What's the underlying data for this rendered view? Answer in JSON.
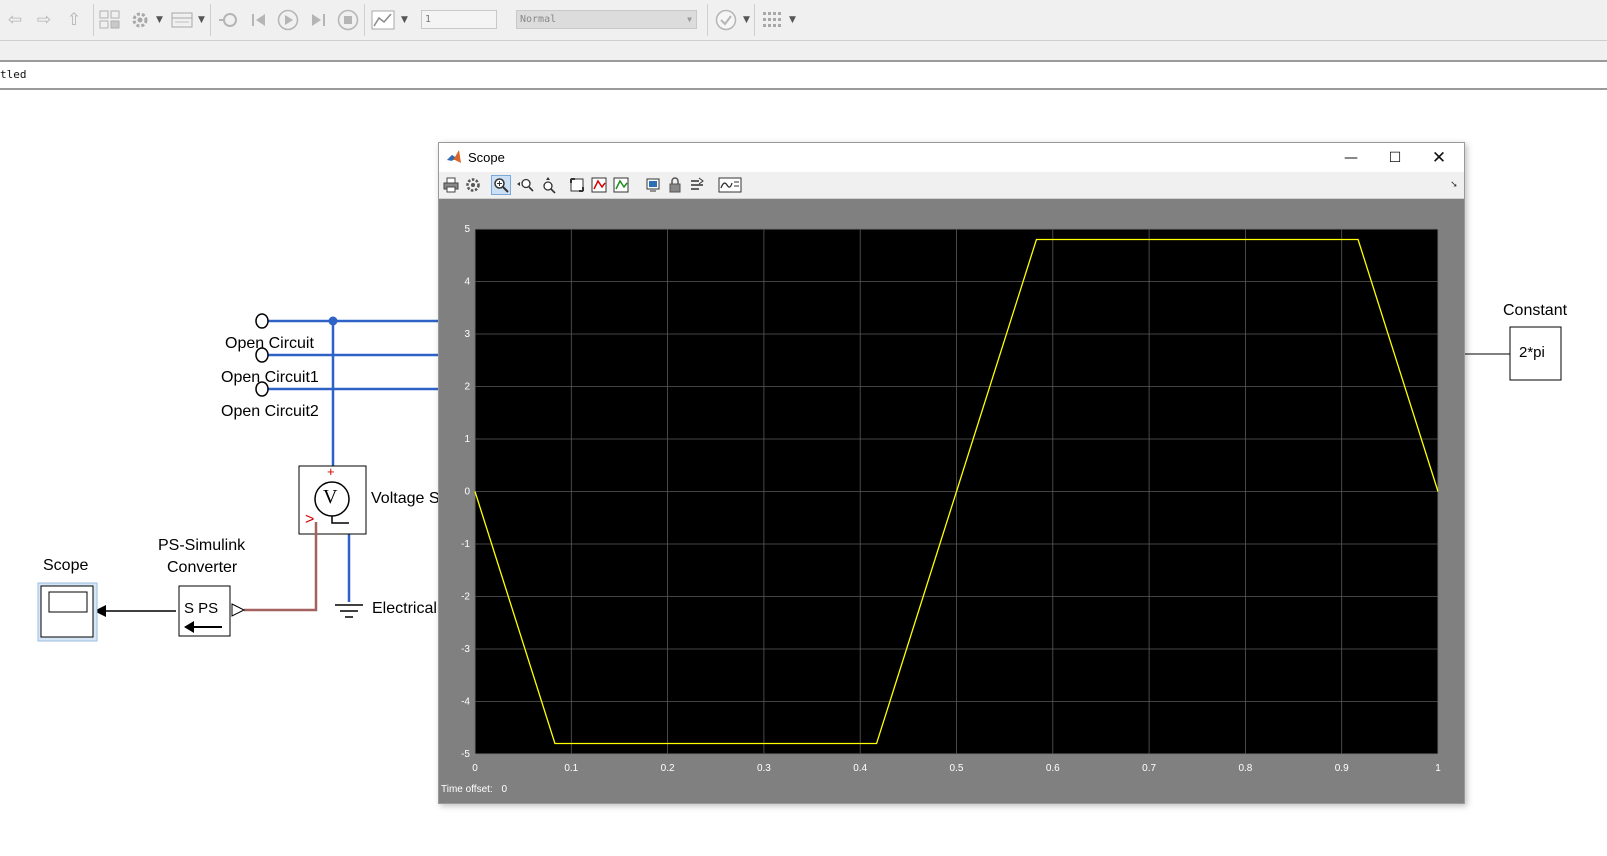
{
  "toolbar": {
    "back_icon": "⇦",
    "forward_icon": "⇨",
    "up_icon": "⇧",
    "stop_time": "1",
    "sim_mode": "Normal"
  },
  "address": {
    "path": "tled"
  },
  "model": {
    "labels": {
      "open_circuit": "Open Circuit",
      "open_circuit1": "Open Circuit1",
      "open_circuit2": "Open Circuit2",
      "voltage_sensor": "Voltage S",
      "electrical_ref": "Electrical",
      "ps_converter_line1": "PS-Simulink",
      "ps_converter_line2": "Converter",
      "ps_converter_glyph": "S PS",
      "scope": "Scope",
      "constant": "Constant",
      "constant_value": "2*pi",
      "vs_glyph": "V",
      "vs_plus": "+",
      "vs_arrow": ">"
    }
  },
  "scope_window": {
    "title": "Scope",
    "time_offset_label": "Time offset:",
    "time_offset_value": "0"
  },
  "chart_data": {
    "type": "line",
    "xlim": [
      0,
      1
    ],
    "ylim": [
      -5,
      5
    ],
    "x_ticks": [
      "0",
      "0.1",
      "0.2",
      "0.3",
      "0.4",
      "0.5",
      "0.6",
      "0.7",
      "0.8",
      "0.9",
      "1"
    ],
    "y_ticks": [
      "5",
      "4",
      "3",
      "2",
      "1",
      "0",
      "-1",
      "-2",
      "-3",
      "-4",
      "-5"
    ],
    "grid": true,
    "background": "#000000",
    "line_color": "#ffff00",
    "series": [
      {
        "x": [
          0,
          0.083,
          0.417,
          0.583,
          0.917,
          1.0
        ],
        "y": [
          0,
          -4.8,
          -4.8,
          4.8,
          4.8,
          0
        ]
      }
    ]
  }
}
